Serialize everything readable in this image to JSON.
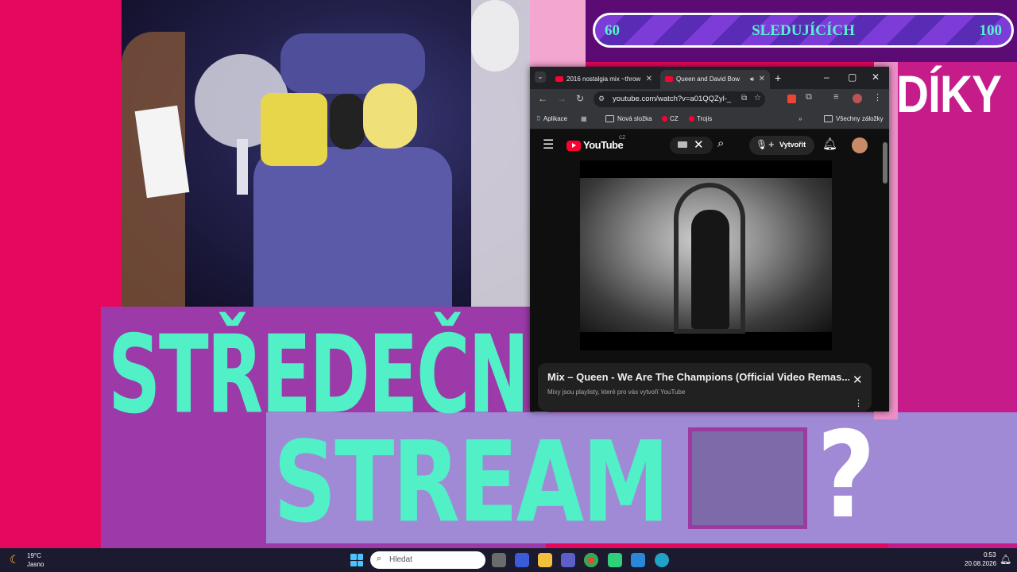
{
  "colors": {
    "title_accent": "#51f0c6",
    "follower_text": "#58f0d0",
    "pink": "#e4085f",
    "purple": "#9b3aa8",
    "lavender": "#a08ad6"
  },
  "follower_goal": {
    "start": "60",
    "label": "SLEDUJÍCÍCH",
    "end": "100",
    "progress_fraction": 0.0
  },
  "thanks_text": "DÍKY",
  "title": {
    "line1": "STŘEDEČNÍ",
    "line2": "STREAM",
    "question": "?"
  },
  "browser": {
    "tabs": [
      {
        "title": "2016 nostalgia mix ~throw",
        "icon": "youtube-icon",
        "active": false
      },
      {
        "title": "Queen and David Bow",
        "icon": "youtube-icon",
        "active": true
      }
    ],
    "url": "youtube.com/watch?v=a01QQZyl-_I...",
    "bookmarks": [
      {
        "label": "Aplikace",
        "icon": "apps-icon"
      },
      {
        "label": "Nová složka",
        "icon": "folder-icon"
      },
      {
        "label": "CZ",
        "icon": "youtube-icon"
      },
      {
        "label": "Trojis",
        "icon": "youtube-icon"
      }
    ],
    "all_bookmarks": "Všechny záložky"
  },
  "youtube": {
    "logo": "YouTube",
    "country": "CZ",
    "create_label": "Vytvořit",
    "mix_title": "Mix – Queen - We Are The Champions (Official Video Remas...",
    "mix_subtitle": "Mixy jsou playlisty, které pro vás vytvoří YouTube"
  },
  "taskbar": {
    "temperature": "19°C",
    "weather": "Jasno",
    "search_placeholder": "Hledat",
    "time": "0:53",
    "date": "20.08.2026"
  }
}
